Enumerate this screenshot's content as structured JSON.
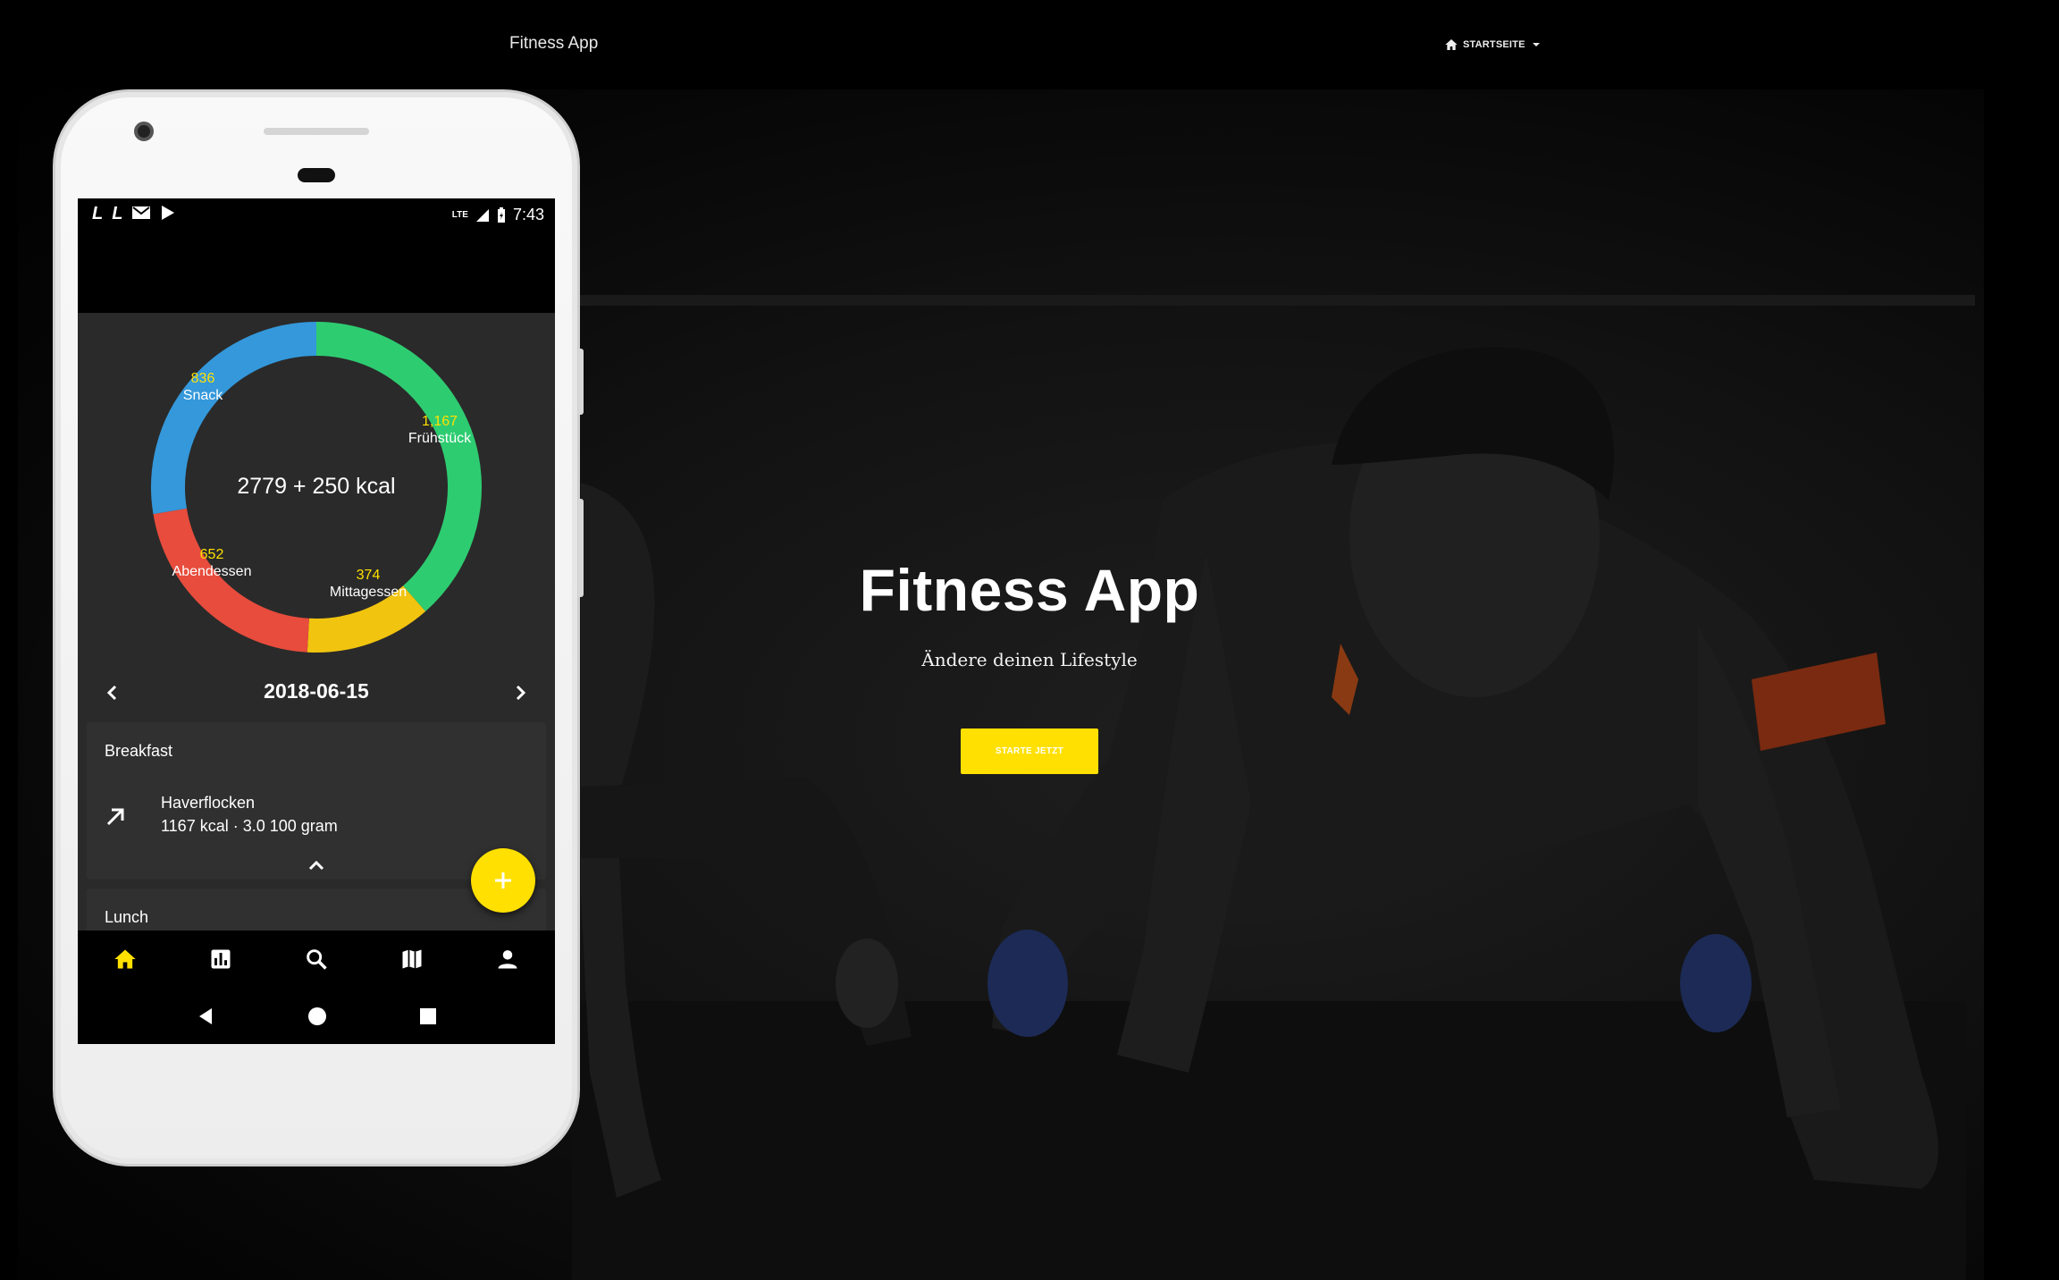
{
  "site": {
    "brand": "Fitness App",
    "nav_home_label": "STARTSEITE",
    "hero_title": "Fitness App",
    "hero_subtitle": "Ändere deinen Lifestyle",
    "cta_label": "STARTE JETZT",
    "accent_color": "#ffe000"
  },
  "phone": {
    "status_time": "7:43",
    "status_network": "LTE",
    "status_notifications": [
      "L",
      "L",
      "mail-icon",
      "play-store-icon"
    ],
    "donut": {
      "center_text": "2779 + 250 kcal",
      "segments": [
        {
          "name": "Frühstück",
          "value": "1,167",
          "color": "#2ecc71"
        },
        {
          "name": "Mittagessen",
          "value": "374",
          "color": "#f1c40f"
        },
        {
          "name": "Abendessen",
          "value": "652",
          "color": "#e74c3c"
        },
        {
          "name": "Snack",
          "value": "836",
          "color": "#3498db"
        }
      ]
    },
    "date": "2018-06-15",
    "meals": [
      {
        "title": "Breakfast",
        "entries": [
          {
            "name": "Haverflocken",
            "meta": "1167 kcal · 3.0 100 gram"
          }
        ]
      },
      {
        "title": "Lunch",
        "entries": []
      }
    ],
    "bottom_nav": [
      "home-icon",
      "stats-icon",
      "search-icon",
      "map-icon",
      "person-icon"
    ],
    "system_nav": [
      "back-icon",
      "home-circle-icon",
      "recents-icon"
    ]
  }
}
